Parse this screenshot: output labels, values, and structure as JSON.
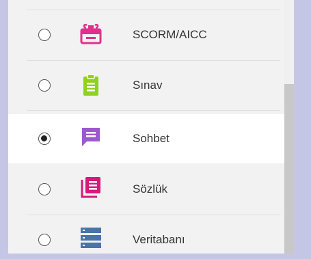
{
  "activities": [
    {
      "label": "SCORM/AICC",
      "icon": "scorm-package-icon",
      "color": "#e0308b",
      "selected": false
    },
    {
      "label": "Sınav",
      "icon": "quiz-clipboard-icon",
      "color": "#8fd11b",
      "selected": false
    },
    {
      "label": "Sohbet",
      "icon": "chat-icon",
      "color": "#9b59d0",
      "selected": true
    },
    {
      "label": "Sözlük",
      "icon": "glossary-icon",
      "color": "#d6197b",
      "selected": false
    },
    {
      "label": "Veritabanı",
      "icon": "database-icon",
      "color": "#4a73a8",
      "selected": false
    }
  ]
}
